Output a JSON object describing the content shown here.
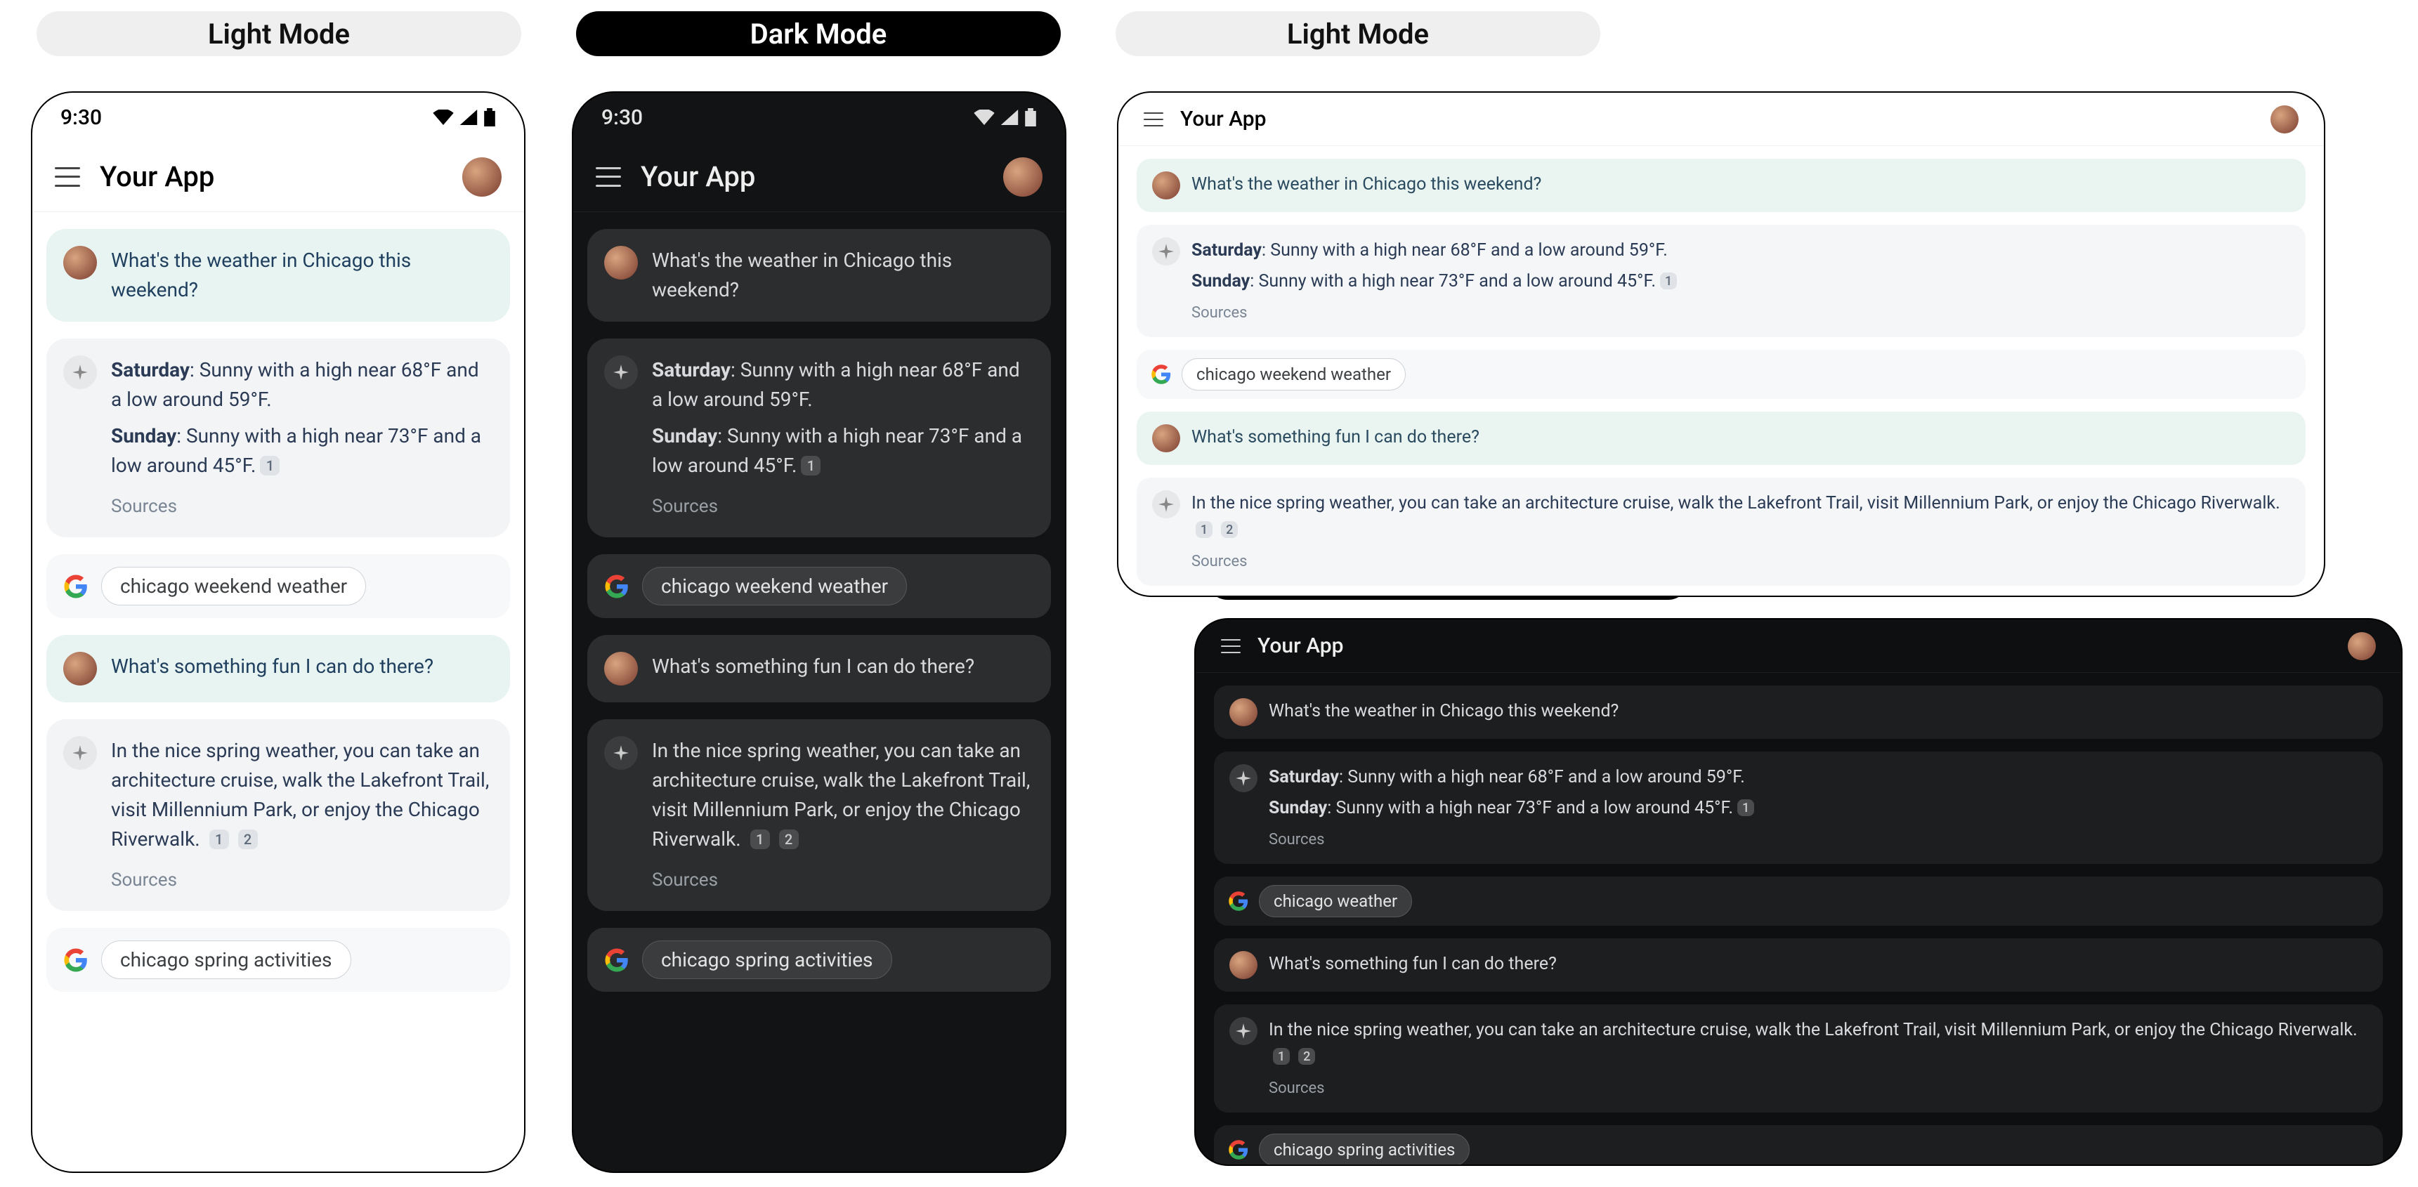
{
  "labels": {
    "light": "Light Mode",
    "dark": "Dark Mode"
  },
  "status": {
    "time": "9:30"
  },
  "app": {
    "title": "Your App"
  },
  "chat": {
    "q1": "What's the weather in Chicago this weekend?",
    "a1": {
      "sat_label": "Saturday",
      "sat_text": ": Sunny with a high near 68°F and a low around 59°F.",
      "sun_label": "Sunday",
      "sun_text": ": Sunny with a high near 73°F and a low around 45°F.",
      "cite1": "1",
      "sources": "Sources"
    },
    "chip1": "chicago weekend weather",
    "q2": "What's something fun I can do there?",
    "a2": {
      "text": "In the nice spring weather, you can take an architecture cruise, walk the Lakefront Trail, visit Millennium Park, or enjoy the Chicago Riverwalk.",
      "cite1": "1",
      "cite2": "2",
      "sources": "Sources"
    },
    "chip2": "chicago spring activities",
    "chip_tablet_dark_weather": "chicago weather"
  }
}
